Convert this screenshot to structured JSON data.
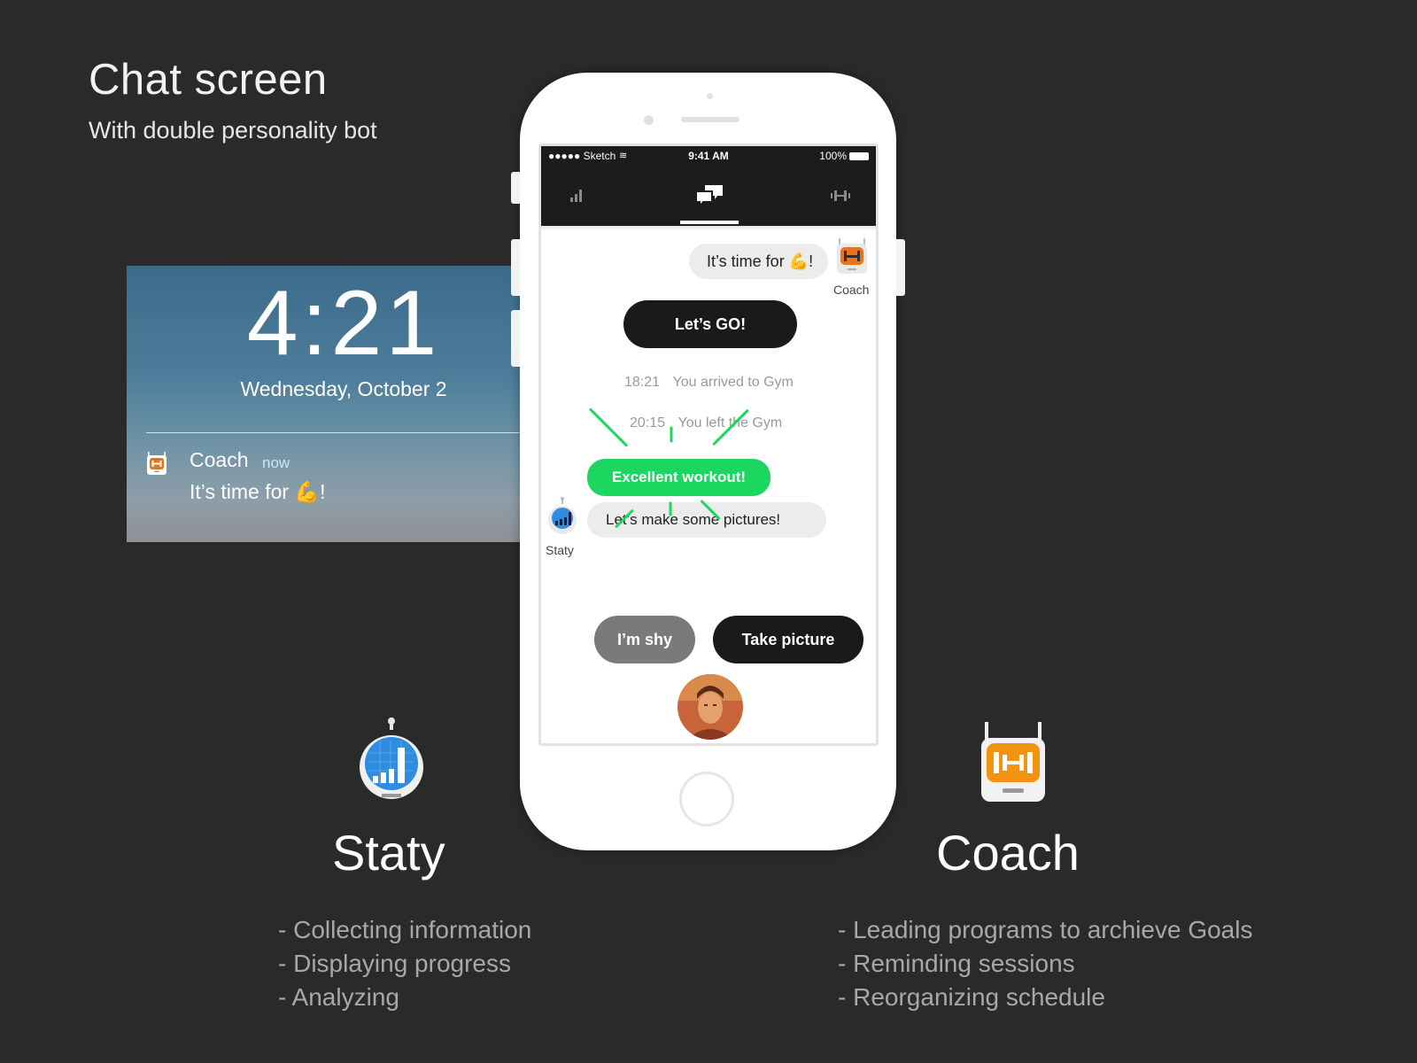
{
  "header": {
    "title": "Chat screen",
    "subtitle": "With double personality bot"
  },
  "lockscreen": {
    "time": "4:21",
    "date": "Wednesday, October 2",
    "notification": {
      "app": "Coach",
      "time": "now",
      "text": "It’s time for 💪!"
    }
  },
  "phone": {
    "statusbar": {
      "carrier": "●●●●● Sketch",
      "time": "9:41 AM",
      "battery": "100%"
    },
    "tabs": [
      {
        "name": "stats-tab",
        "icon": "bar-chart-icon"
      },
      {
        "name": "chat-tab",
        "icon": "chat-bubbles-icon",
        "active": true
      },
      {
        "name": "workout-tab",
        "icon": "dumbbell-icon"
      }
    ],
    "chat": {
      "coach_message": "It’s time for 💪!",
      "coach_label": "Coach",
      "lets_go": "Let’s GO!",
      "events": [
        {
          "time": "18:21",
          "text": "You arrived to Gym"
        },
        {
          "time": "20:15",
          "text": "You left the Gym"
        }
      ],
      "excellent": "Excellent workout!",
      "staty_message": "Let’s make some pictures!",
      "staty_label": "Staty",
      "reply_shy": "I’m shy",
      "reply_take": "Take picture"
    }
  },
  "bots": {
    "staty": {
      "name": "Staty",
      "features": [
        "- Collecting information",
        "- Displaying progress",
        "- Analyzing"
      ]
    },
    "coach": {
      "name": "Coach",
      "features": [
        "- Leading programs to archieve Goals",
        "- Reminding sessions",
        "- Reorganizing schedule"
      ]
    }
  },
  "colors": {
    "background": "#2a2a2a",
    "accent_green": "#1bd760",
    "coach_orange": "#f29312",
    "staty_blue": "#2f8cde"
  }
}
